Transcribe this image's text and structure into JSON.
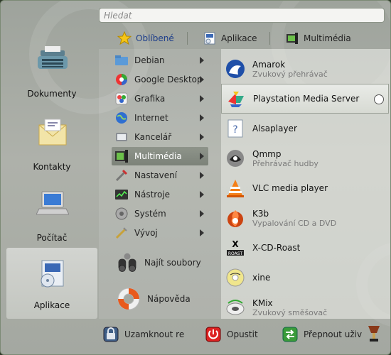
{
  "search": {
    "placeholder": "Hledat"
  },
  "tabs": [
    {
      "label": "Oblíbené",
      "icon": "star-icon"
    },
    {
      "label": "Aplikace",
      "icon": "applications-icon"
    },
    {
      "label": "Multimédia",
      "icon": "multimedia-icon"
    }
  ],
  "left": [
    {
      "label": "Dokumenty",
      "icon": "typewriter-icon"
    },
    {
      "label": "Kontakty",
      "icon": "contacts-icon"
    },
    {
      "label": "Počítač",
      "icon": "laptop-icon"
    },
    {
      "label": "Aplikace",
      "icon": "applications-box-icon"
    }
  ],
  "categories": [
    {
      "label": "Debian",
      "icon": "folder-icon"
    },
    {
      "label": "Google Desktop",
      "icon": "google-desktop-icon"
    },
    {
      "label": "Grafika",
      "icon": "graphics-icon"
    },
    {
      "label": "Internet",
      "icon": "globe-icon"
    },
    {
      "label": "Kancelář",
      "icon": "office-icon"
    },
    {
      "label": "Multimédia",
      "icon": "multimedia-icon"
    },
    {
      "label": "Nastavení",
      "icon": "settings-tools-icon"
    },
    {
      "label": "Nástroje",
      "icon": "utilities-icon"
    },
    {
      "label": "Systém",
      "icon": "gear-icon"
    },
    {
      "label": "Vývoj",
      "icon": "development-icon"
    }
  ],
  "actions": {
    "find": "Najít soubory/s",
    "help": "Nápověda"
  },
  "apps": [
    {
      "name": "Amarok",
      "desc": "Zvukový přehrávač",
      "icon": "amarok-icon"
    },
    {
      "name": "Playstation Media Server",
      "desc": "",
      "icon": "playstation-icon"
    },
    {
      "name": "Alsaplayer",
      "desc": "",
      "icon": "unknown-app-icon"
    },
    {
      "name": "Qmmp",
      "desc": "Přehrávač hudby",
      "icon": "qmmp-icon"
    },
    {
      "name": "VLC media player",
      "desc": "",
      "icon": "vlc-cone-icon"
    },
    {
      "name": "K3b",
      "desc": "Vypalování CD a DVD",
      "icon": "k3b-icon"
    },
    {
      "name": "X-CD-Roast",
      "desc": "",
      "icon": "xcdroast-icon"
    },
    {
      "name": "xine",
      "desc": "",
      "icon": "xine-icon"
    },
    {
      "name": "KMix",
      "desc": "Zvukový směšovač",
      "icon": "kmix-icon"
    }
  ],
  "bottom": {
    "lock": "Uzamknout re",
    "logout": "Opustit",
    "switch": "Přepnout uživ"
  },
  "colors": {
    "accent": "#1c3d8a",
    "selected": "#7c8279",
    "background": "#a4a8a1"
  }
}
